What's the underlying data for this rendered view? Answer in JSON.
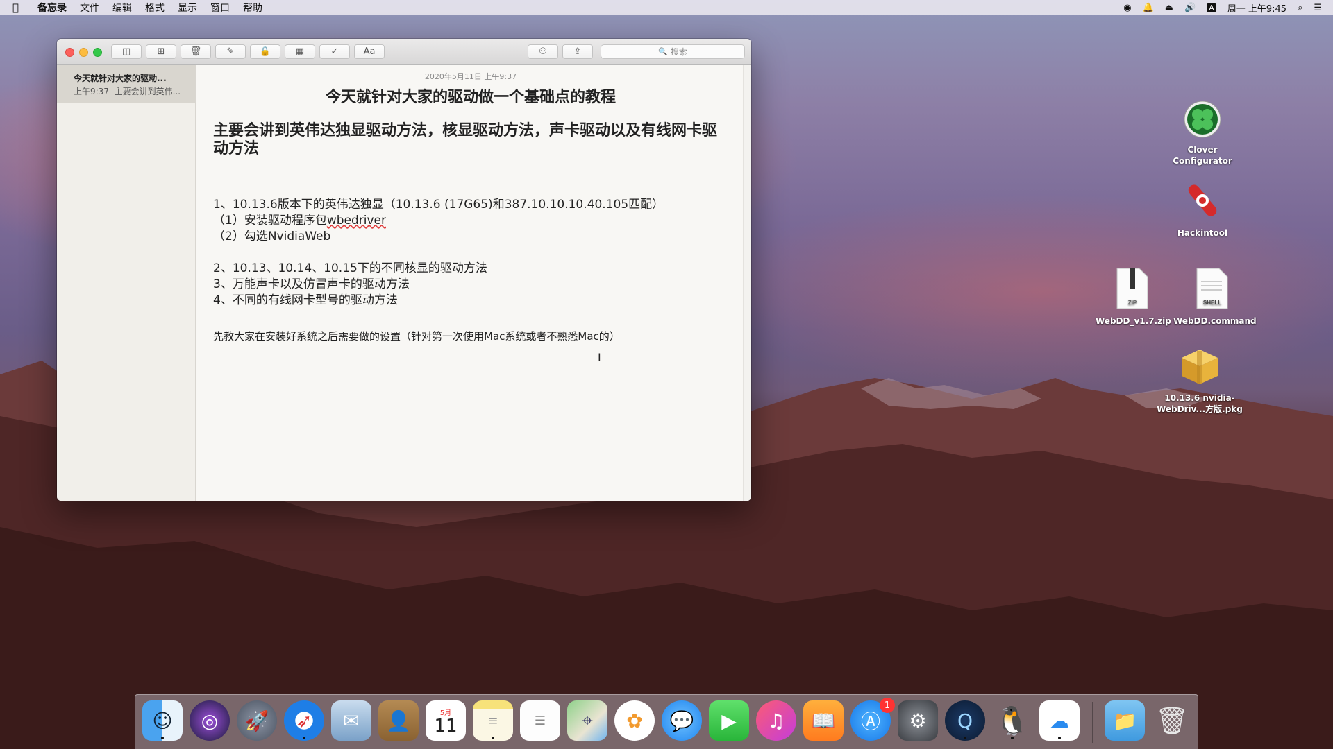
{
  "menubar": {
    "app_name": "备忘录",
    "items": [
      "文件",
      "编辑",
      "格式",
      "显示",
      "窗口",
      "帮助"
    ],
    "clock": "周一 上午9:45"
  },
  "window": {
    "search_placeholder": "搜索",
    "format_button_label": "Aa"
  },
  "sidebar": {
    "notes": [
      {
        "title": "今天就针对大家的驱动...",
        "time": "上午9:37",
        "snippet": "主要会讲到英伟..."
      }
    ]
  },
  "note": {
    "date": "2020年5月11日 上午9:37",
    "title": "今天就针对大家的驱动做一个基础点的教程",
    "heading": "主要会讲到英伟达独显驱动方法，核显驱动方法，声卡驱动以及有线网卡驱动方法",
    "lines": [
      "1、10.13.6版本下的英伟达独显（10.13.6 (17G65)和387.10.10.10.40.105匹配）",
      "（1）安装驱动程序包",
      "wbedriver",
      "（2）勾选NvidiaWeb",
      "2、10.13、10.14、10.15下的不同核显的驱动方法",
      "3、万能声卡以及仿冒声卡的驱动方法",
      "4、不同的有线网卡型号的驱动方法",
      "先教大家在安装好系统之后需要做的设置（针对第一次使用Mac系统或者不熟悉Mac的）"
    ]
  },
  "desktop_icons": [
    {
      "label_line1": "Clover",
      "label_line2": "Configurator"
    },
    {
      "label_line1": "Hackintool",
      "label_line2": ""
    },
    {
      "label_line1": "WebDD_v1.7.zip",
      "label_line2": "",
      "badge_text": "ZIP"
    },
    {
      "label_line1": "WebDD.command",
      "label_line2": "",
      "badge_text": "SHELL"
    },
    {
      "label_line1": "10.13.6 nvidia-",
      "label_line2": "WebDriv...方版.pkg"
    }
  ],
  "dock": {
    "calendar_month": "5月",
    "calendar_day": "11",
    "appstore_badge": "1"
  }
}
